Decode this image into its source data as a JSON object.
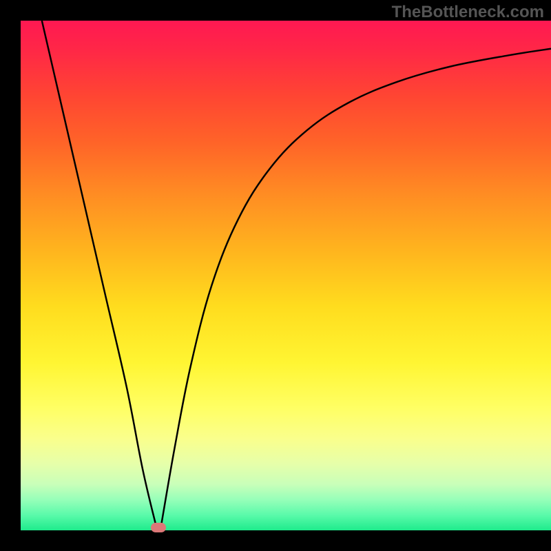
{
  "watermark": "TheBottleneck.com",
  "chart_data": {
    "type": "line",
    "title": "",
    "xlabel": "",
    "ylabel": "",
    "xlim": [
      0,
      100
    ],
    "ylim": [
      0,
      100
    ],
    "background_gradient": {
      "direction": "vertical",
      "stops": [
        {
          "pos": 0,
          "color": "#ff1852",
          "meaning": "high"
        },
        {
          "pos": 50,
          "color": "#ffc81e",
          "meaning": "medium"
        },
        {
          "pos": 100,
          "color": "#1eeb8c",
          "meaning": "low"
        }
      ]
    },
    "series": [
      {
        "name": "left-branch",
        "x": [
          4,
          8,
          12,
          16,
          20,
          23,
          25.5
        ],
        "y": [
          100,
          82,
          64,
          46,
          28,
          12,
          1
        ]
      },
      {
        "name": "right-branch",
        "x": [
          26.5,
          29,
          32,
          36,
          41,
          47,
          54,
          62,
          71,
          81,
          92,
          100
        ],
        "y": [
          1,
          16,
          32,
          48,
          61,
          71,
          78.5,
          84,
          88,
          91,
          93.2,
          94.5
        ]
      }
    ],
    "annotations": [
      {
        "name": "minimum-marker",
        "x": 26,
        "y": 0.5,
        "shape": "pill",
        "color": "#dc7878"
      }
    ],
    "notes": "V-shaped bottleneck curve. Left branch is near-linear descent; right branch rises with diminishing slope (saturating). Minimum at roughly x=26. Values are estimates read from an unlabeled chart."
  }
}
